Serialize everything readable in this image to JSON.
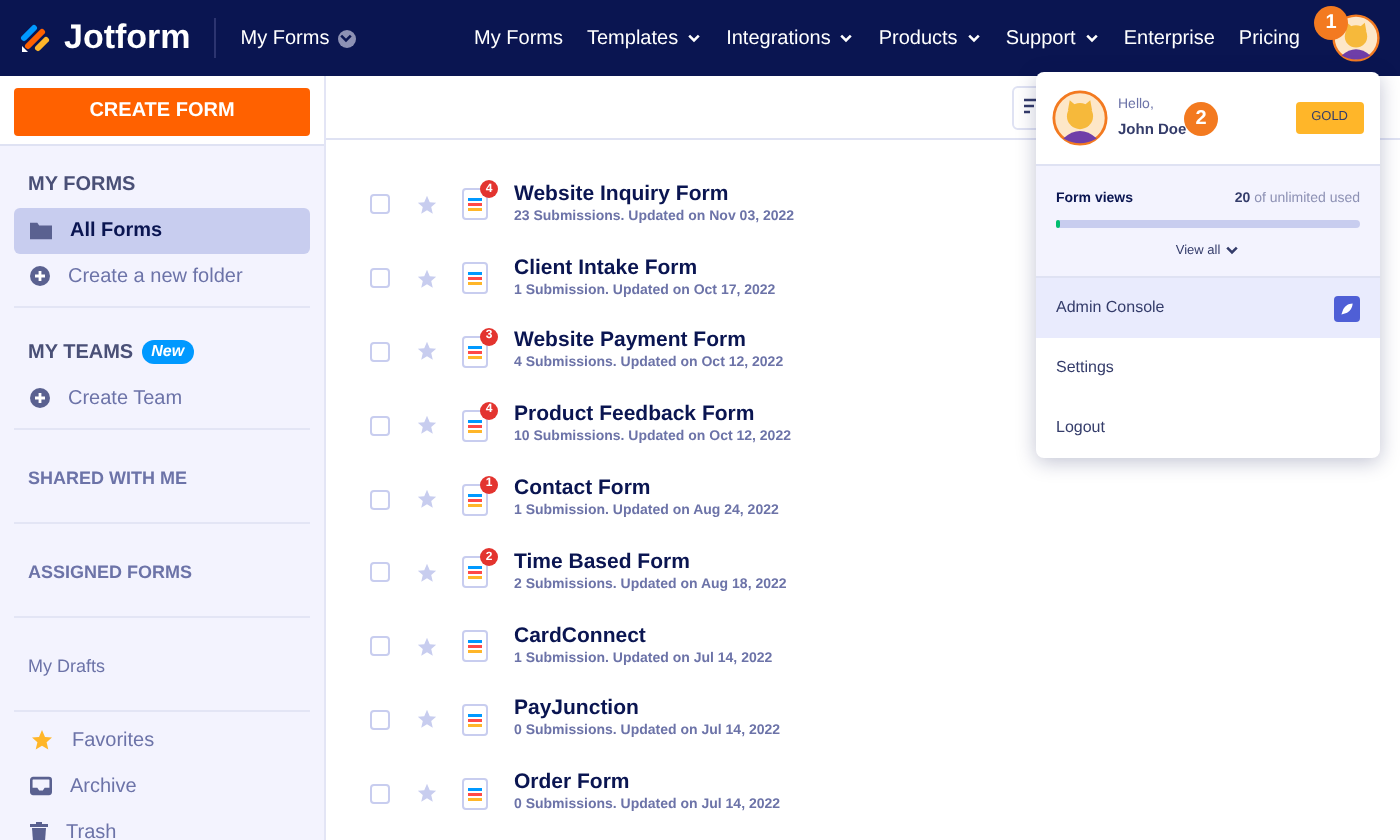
{
  "header": {
    "logo": "Jotform",
    "workspace_menu": "My Forms",
    "nav": [
      {
        "label": "My Forms",
        "has_menu": false
      },
      {
        "label": "Templates",
        "has_menu": true
      },
      {
        "label": "Integrations",
        "has_menu": true
      },
      {
        "label": "Products",
        "has_menu": true
      },
      {
        "label": "Support",
        "has_menu": true
      },
      {
        "label": "Enterprise",
        "has_menu": false
      },
      {
        "label": "Pricing",
        "has_menu": false
      }
    ]
  },
  "callouts": [
    "1",
    "2"
  ],
  "sidebar": {
    "create_button": "CREATE FORM",
    "sections": [
      {
        "kind": "heading",
        "label": "MY FORMS"
      },
      {
        "kind": "item",
        "label": "All Forms",
        "selected": true
      },
      {
        "kind": "item",
        "label": "Create a new folder",
        "selected": false
      },
      {
        "kind": "divider"
      },
      {
        "kind": "heading",
        "label": "MY TEAMS",
        "badge": "New"
      },
      {
        "kind": "item",
        "label": "Create Team",
        "selected": false
      },
      {
        "kind": "divider"
      },
      {
        "kind": "section",
        "label": "SHARED WITH ME"
      },
      {
        "kind": "divider"
      },
      {
        "kind": "section",
        "label": "ASSIGNED FORMS"
      },
      {
        "kind": "divider"
      },
      {
        "kind": "plain",
        "label": "My Drafts"
      },
      {
        "kind": "divider"
      },
      {
        "kind": "item",
        "label": "Favorites",
        "selected": false
      },
      {
        "kind": "item",
        "label": "Archive",
        "selected": false
      },
      {
        "kind": "item",
        "label": "Trash",
        "selected": false
      }
    ]
  },
  "forms": [
    {
      "title": "Website Inquiry Form",
      "meta": "23 Submissions. Updated on Nov 03, 2022",
      "badge": "4",
      "checked": false
    },
    {
      "title": "Client Intake Form",
      "meta": "1 Submission. Updated on Oct 17, 2022",
      "checked": false
    },
    {
      "title": "Website Payment Form",
      "meta": "4 Submissions. Updated on Oct 12, 2022",
      "badge": "3",
      "checked": false
    },
    {
      "title": "Product Feedback Form",
      "meta": "10 Submissions. Updated on Oct 12, 2022",
      "badge": "4",
      "checked": false
    },
    {
      "title": "Contact Form",
      "meta": "1 Submission. Updated on Aug 24, 2022",
      "badge": "1",
      "checked": false
    },
    {
      "title": "Time Based Form",
      "meta": "2 Submissions. Updated on Aug 18, 2022",
      "badge": "2",
      "checked": false
    },
    {
      "title": "CardConnect",
      "meta": "1 Submission. Updated on Jul 14, 2022",
      "checked": false
    },
    {
      "title": "PayJunction",
      "meta": "0 Submissions. Updated on Jul 14, 2022",
      "checked": false
    },
    {
      "title": "Order Form",
      "meta": "0 Submissions. Updated on Jul 14, 2022",
      "checked": false
    }
  ],
  "account_menu": {
    "greeting": "Hello,",
    "name": "John Doe",
    "plan": "GOLD",
    "usage": {
      "label": "Form views",
      "count": "20",
      "suffix": "of unlimited used",
      "level": 0.01,
      "link": "View all"
    },
    "items": [
      {
        "label": "Admin Console",
        "selected": true
      },
      {
        "label": "Settings",
        "selected": false
      },
      {
        "label": "Logout",
        "selected": false
      }
    ]
  }
}
